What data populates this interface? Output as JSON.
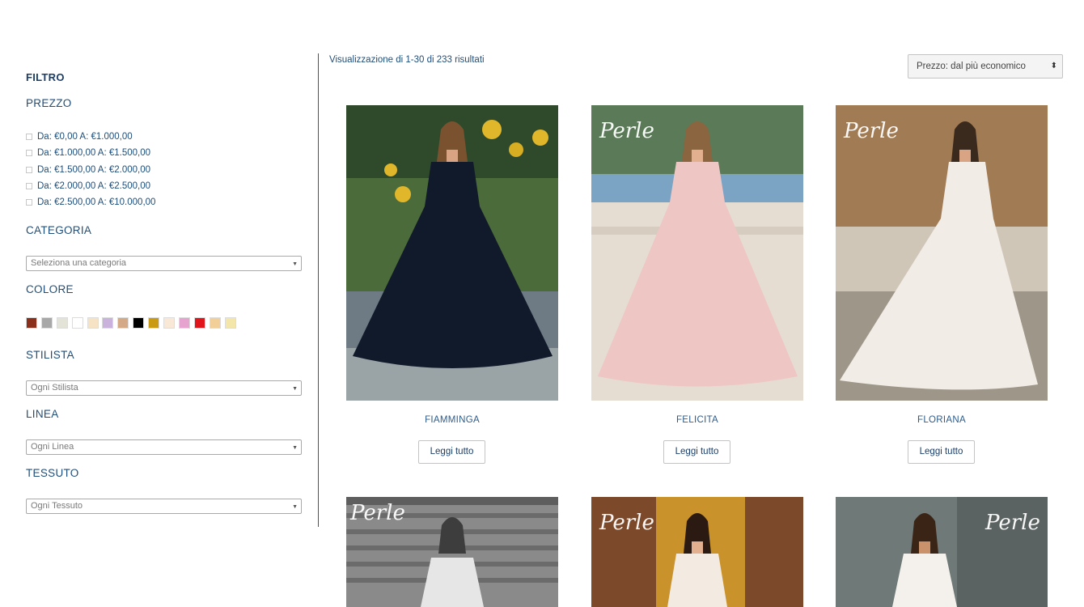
{
  "sidebar": {
    "filter_title": "FILTRO",
    "price": {
      "title": "PREZZO",
      "options": [
        "Da: €0,00 A: €1.000,00",
        "Da: €1.000,00 A: €1.500,00",
        "Da: €1.500,00 A: €2.000,00",
        "Da: €2.000,00 A: €2.500,00",
        "Da: €2.500,00 A: €10.000,00"
      ]
    },
    "category": {
      "title": "CATEGORIA",
      "placeholder": "Seleziona una categoria"
    },
    "color": {
      "title": "COLORE",
      "swatches": [
        "#8b2e1a",
        "#a8a8a8",
        "#e3e3d8",
        "#ffffff",
        "#f6e2c4",
        "#c9b3dc",
        "#d4a986",
        "#000000",
        "#c99a12",
        "#f9e8d6",
        "#e7a3cf",
        "#e0141a",
        "#f2cf97",
        "#f4e5a8"
      ]
    },
    "stylist": {
      "title": "STILISTA",
      "placeholder": "Ogni Stilista"
    },
    "line": {
      "title": "LINEA",
      "placeholder": "Ogni Linea"
    },
    "fabric": {
      "title": "TESSUTO",
      "placeholder": "Ogni Tessuto"
    }
  },
  "main": {
    "results_text": "Visualizzazione di 1-30 di 233 risultati",
    "sort_selected": "Prezzo: dal più economico",
    "read_more_label": "Leggi tutto",
    "brand_watermark": "Perle",
    "products": [
      {
        "name": "FIAMMINGA",
        "dress_color": "#111a2a"
      },
      {
        "name": "FELICITA",
        "dress_color": "#eec6c4"
      },
      {
        "name": "FLORIANA",
        "dress_color": "#f1ece6"
      },
      {
        "name": "",
        "dress_color": "#e6e6e6"
      },
      {
        "name": "",
        "dress_color": "#f3ebe2"
      },
      {
        "name": "",
        "dress_color": "#f4f1ec"
      }
    ]
  }
}
